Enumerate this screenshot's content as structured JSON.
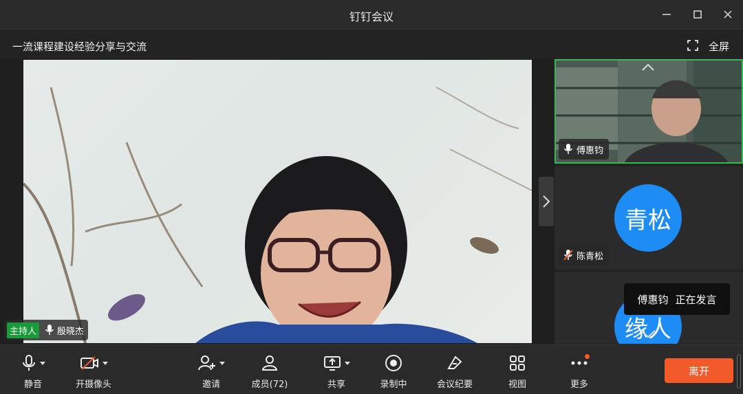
{
  "window": {
    "title": "钉钉会议"
  },
  "meeting": {
    "title": "一流课程建设经验分享与交流",
    "fullscreen_label": "全屏"
  },
  "main_video": {
    "host_badge": "主持人",
    "speaker_name": "殷晓杰"
  },
  "participants": [
    {
      "name": "傅惠钧",
      "mic": "on",
      "video": true
    },
    {
      "name": "陈青松",
      "avatar_text": "青松",
      "mic": "muted"
    },
    {
      "name": "",
      "avatar_text": "缘人"
    }
  ],
  "speaking_toast": {
    "name": "傅惠钧",
    "status": "正在发言"
  },
  "toolbar": {
    "mute": "静音",
    "camera": "开摄像头",
    "invite": "邀请",
    "members": "成员(72)",
    "share": "共享",
    "record": "录制中",
    "minutes": "会议纪要",
    "view": "视图",
    "more": "更多",
    "leave": "离开"
  },
  "colors": {
    "accent_green": "#2fbf4a",
    "avatar_blue": "#1e8cf5",
    "leave_orange": "#f25a2a"
  }
}
